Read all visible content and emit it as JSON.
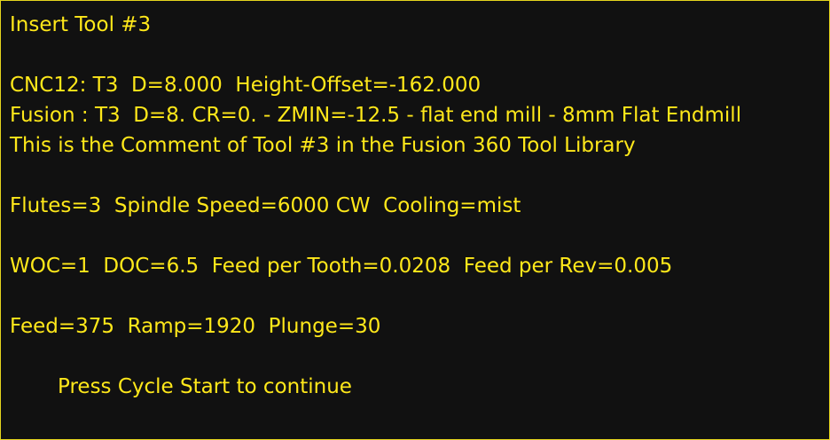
{
  "title": "Insert Tool #3",
  "cnc_line": "CNC12: T3  D=8.000  Height-Offset=-162.000",
  "fusion_line": "Fusion : T3  D=8. CR=0. - ZMIN=-12.5 - flat end mill - 8mm Flat Endmill",
  "comment_line": "This is the Comment of Tool #3 in the Fusion 360 Tool Library",
  "spindle_line": "Flutes=3  Spindle Speed=6000 CW  Cooling=mist",
  "cutting_line": "WOC=1  DOC=6.5  Feed per Tooth=0.0208  Feed per Rev=0.005",
  "feed_line": "Feed=375  Ramp=1920  Plunge=30",
  "prompt": "Press Cycle Start to continue",
  "colors": {
    "background": "#111111",
    "text": "#ffe81a",
    "border": "#e6d51e"
  }
}
